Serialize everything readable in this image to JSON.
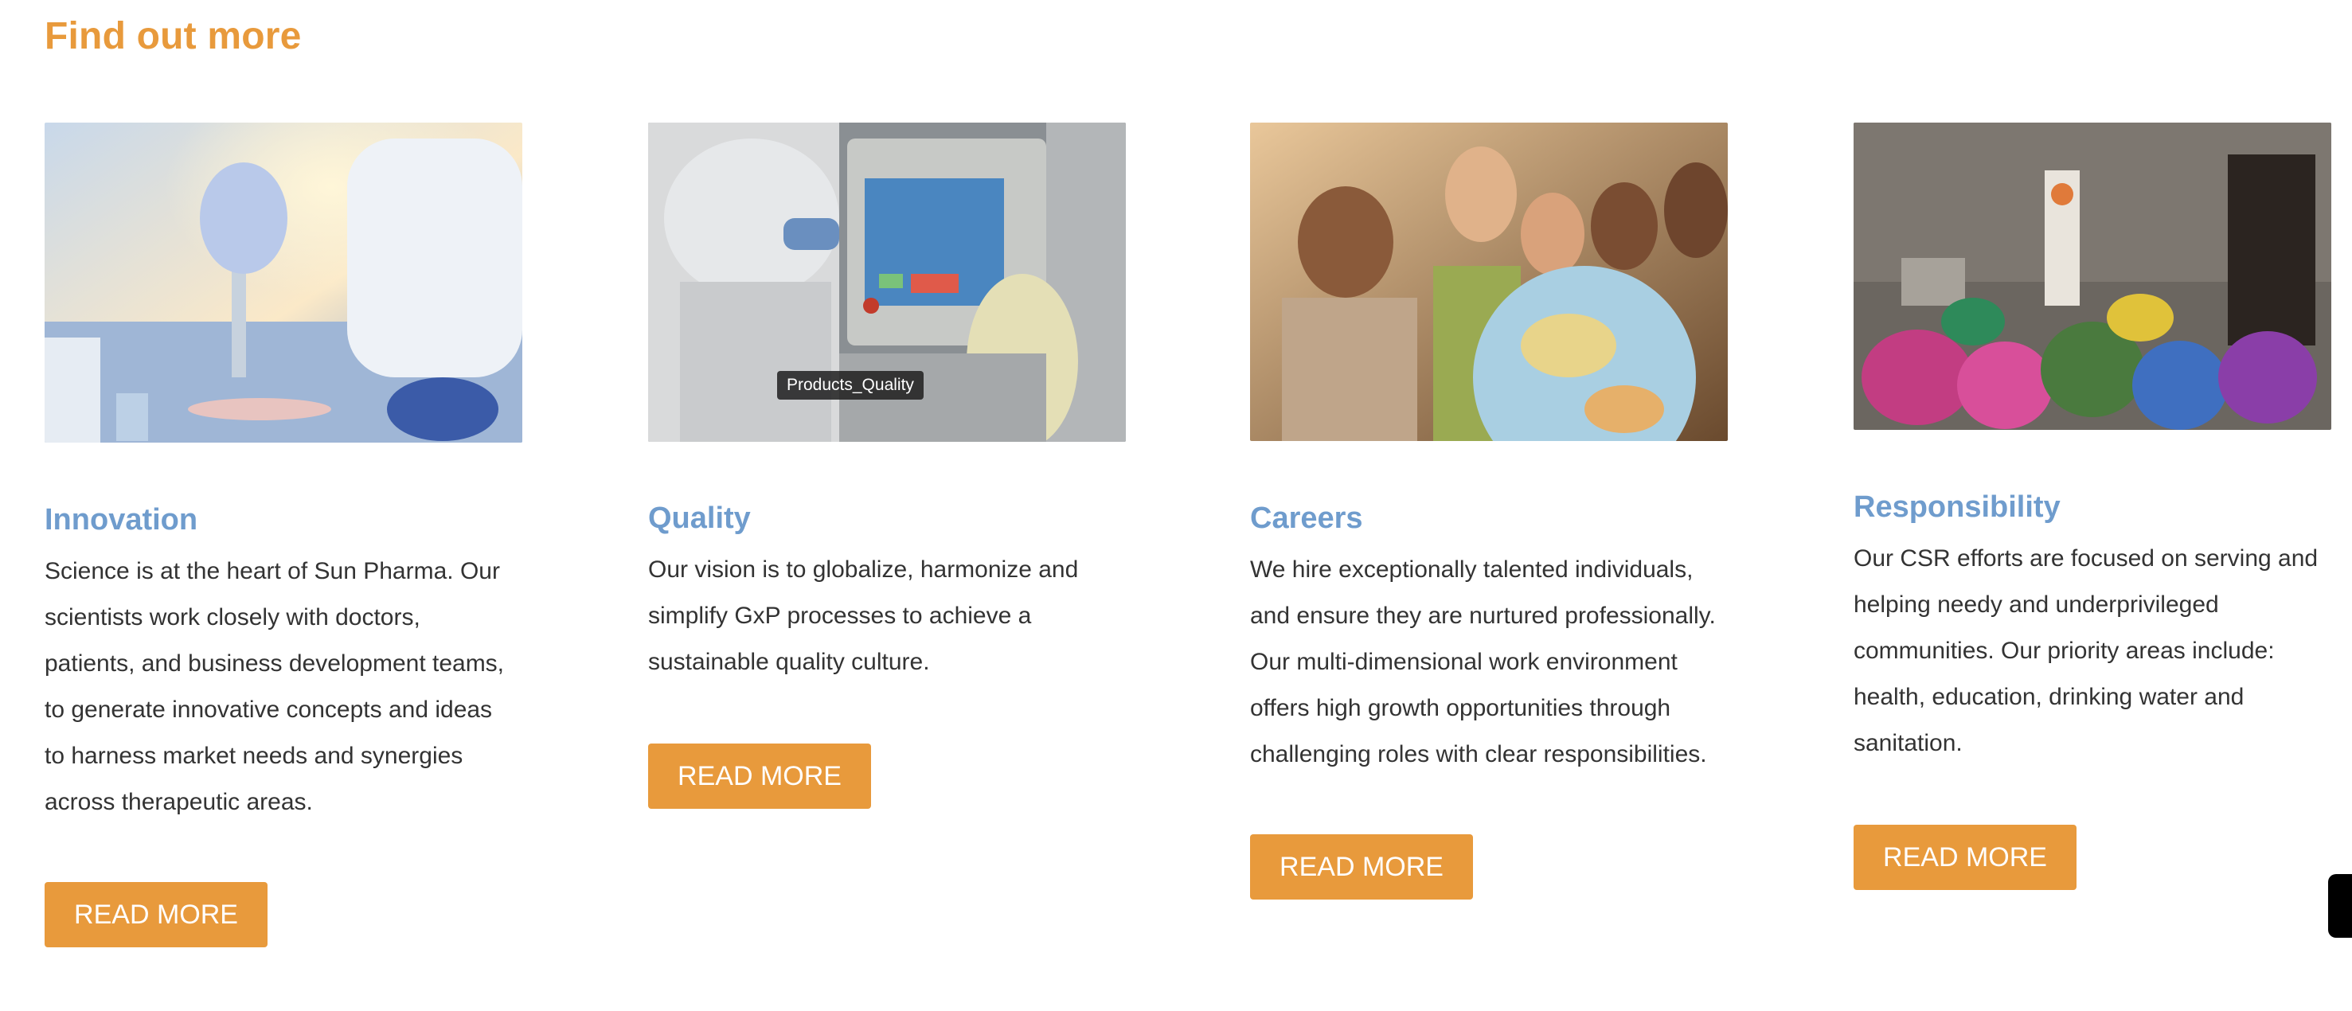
{
  "section": {
    "title": "Find out more"
  },
  "colors": {
    "accent": "#e89a3c",
    "card_title": "#6f9ccd",
    "body_text": "#333333"
  },
  "cards": [
    {
      "title": "Innovation",
      "text": "Science is at the heart of Sun Pharma. Our scientists work closely with doctors, patients, and business development teams, to generate innovative concepts and ideas to harness market needs and synergies across therapeutic areas.",
      "lines": [
        "Science is at the heart of Sun Pharma. Our",
        "scientists work closely with doctors,",
        "patients, and business development teams,",
        "to generate innovative concepts and ideas",
        "to harness market needs and synergies",
        "across therapeutic areas."
      ],
      "button": "READ MORE"
    },
    {
      "title": "Quality",
      "tooltip": "Products_Quality",
      "lines": [
        "Our vision is to globalize, harmonize and",
        "simplify GxP processes to achieve a",
        "sustainable quality culture."
      ],
      "button": "READ MORE"
    },
    {
      "title": "Careers",
      "lines": [
        "We hire exceptionally talented individuals,",
        "and ensure they are nurtured professionally.",
        "Our multi-dimensional work environment",
        "offers high growth opportunities through",
        "challenging roles with clear responsibilities."
      ],
      "button": "READ MORE"
    },
    {
      "title": "Responsibility",
      "lines": [
        "Our CSR efforts are focused on serving and",
        "helping needy and underprivileged",
        "communities. Our priority areas include:",
        "health, education, drinking water and",
        "sanitation."
      ],
      "button": "READ MORE"
    }
  ]
}
